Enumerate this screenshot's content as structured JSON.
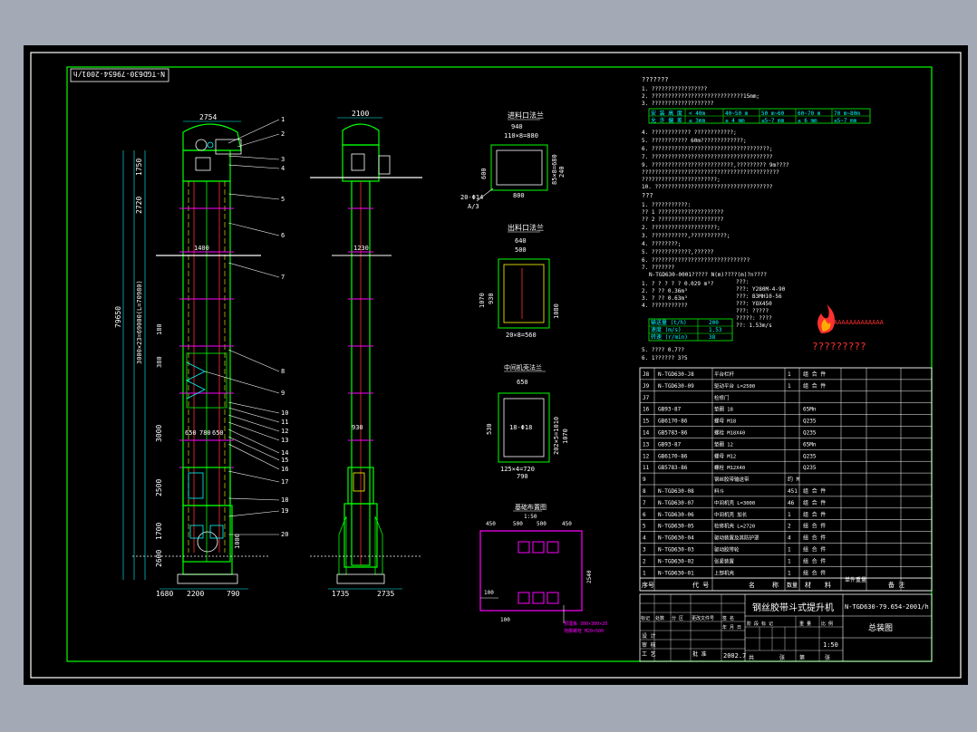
{
  "drawing": {
    "code_box": "N-TGD630-79654-2001/h",
    "code_title": "N-TGD630-79.654-2001/h",
    "machine_name": "钢丝胶带斗式提升机",
    "drawing_name": "总装图",
    "scale": "1:50",
    "date": "2002.7"
  },
  "front_view": {
    "top_width": "2754",
    "dims_left": [
      "1750",
      "2720",
      "79650",
      "3000",
      "2500",
      "1700",
      "2600"
    ],
    "long_dim": "3000×23=69000(L=70980)",
    "mid_dims": [
      "1400",
      "650",
      "780",
      "650"
    ],
    "small_dims": [
      "180",
      "380"
    ],
    "bottom_dims": [
      "1680",
      "2200",
      "790"
    ],
    "callouts": [
      "1",
      "2",
      "3",
      "4",
      "5",
      "6",
      "7",
      "8",
      "9",
      "10",
      "11",
      "12",
      "13",
      "14",
      "15",
      "16",
      "17",
      "18",
      "19",
      "20"
    ],
    "right_dim": "1000"
  },
  "side_view": {
    "top_dim": "2100",
    "mid_dims": [
      "1230",
      "930"
    ],
    "bottom_dims": [
      "1735",
      "2735"
    ]
  },
  "details": {
    "inlet": {
      "title": "进料口法兰",
      "dims": [
        "940",
        "110×8=880",
        "600",
        "800",
        "240",
        "85×8=680"
      ],
      "holes": "20-Φ14",
      "ref": "A/3"
    },
    "outlet": {
      "title": "出料口法兰",
      "dims": [
        "640",
        "500",
        "1070",
        "930",
        "1080",
        "20×8=560"
      ]
    },
    "middle": {
      "title": "中间机壳法兰",
      "dims": [
        "650",
        "530",
        "1070",
        "790",
        "18-Φ18",
        "202×5=1010",
        "125×4=720"
      ]
    },
    "foundation": {
      "title": "基础布置图",
      "subtitle": "1:50",
      "dims": [
        "450",
        "500",
        "500",
        "450",
        "100",
        "2540",
        "100"
      ],
      "note1": "预埋板 300×300×20",
      "note2": "地脚螺栓 M20×500"
    }
  },
  "notes": {
    "title1": "???????",
    "items1": [
      "1. ?????????????????",
      "2. ????????????????????????????15mm;",
      "3. ???????????????????"
    ],
    "table_row1": [
      "安 装 高 度",
      "< 40m",
      "40~50 m",
      "50 m~60",
      "60~70 m",
      "70 m~80m"
    ],
    "table_row2": [
      "允 许 偏 差",
      "≤ 3mm",
      "≤ 4 mm",
      "≤5~7 mm",
      "≤ 6 mm",
      "≤5~7 mm"
    ],
    "items2": [
      "4. ????????????     ????????????;",
      "5. ???????????      60m?????????????;",
      "6. ????????????????????????????????????;",
      "7. ?????????????????????????????????????",
      "9. ?????????????????????????,?????????            9m????",
      "   ??????????????????????????????????????????",
      "   ???????????????????????;",
      "10. ????????????????????????????????????"
    ],
    "title2": "???",
    "items3": [
      "1. ???????????:",
      "   ?? 1 ????????????????????",
      "   ?? 2 ????????????????????",
      "2. ????????????????????;",
      "3. ???????????,???????????;",
      "4. ????????;",
      "5. ????????????,??????",
      "6. ??????????????????????????????",
      "7. ???????"
    ],
    "spec_line": "N-TGD630-0001????? N(m)????(m)?n????",
    "spec_col1": [
      "1. ? ? ? ? ?  0.029 m³?",
      "2. ?     ?? 0.36m³",
      "3. ?     ?? 0.63m³",
      "4. ???????????"
    ],
    "spec_col2": [
      "???:",
      "???: Y280M-4-90",
      "???: B3MH10-56",
      "???: YOX450",
      "???: ?????",
      "?????:   ????",
      "??: 1.53m/s"
    ],
    "perf_table": [
      [
        "输送量  (t/h)",
        "200"
      ],
      [
        "速度  (m/s)",
        "1.53"
      ],
      [
        "转速  (r/min)",
        "38"
      ]
    ],
    "items4": [
      "5. ????  0.7??",
      "6. 1??????  3?5"
    ],
    "logo_text1": "AAAAAAAAAAAAA",
    "logo_text2": "?????????"
  },
  "bom": {
    "rows": [
      [
        "J8",
        "N-TGD630-J8",
        "平台栏杆",
        "1",
        "组 合 件",
        ""
      ],
      [
        "J9",
        "N-TGD630-09",
        "驱动平台 L=2500",
        "1",
        "组 合 件",
        ""
      ],
      [
        "J7",
        "",
        "检修门",
        "",
        "",
        ""
      ],
      [
        "16",
        "GB93-87",
        "垫圈 18",
        "",
        "65Mn",
        ""
      ],
      [
        "15",
        "GB6170-86",
        "螺母 M18",
        "",
        "Q235",
        ""
      ],
      [
        "14",
        "GB5783-86",
        "螺栓 M18X40",
        "",
        "Q235",
        ""
      ],
      [
        "13",
        "GB93-87",
        "垫圈 12",
        "",
        "65Mn",
        ""
      ],
      [
        "12",
        "GB6170-86",
        "螺母 M12",
        "",
        "Q235",
        ""
      ],
      [
        "11",
        "GB5783-86",
        "螺栓 M12X40",
        "",
        "Q235",
        ""
      ],
      [
        "9",
        "",
        "钢丝胶带输送带",
        "约 M",
        "",
        ""
      ],
      [
        "8",
        "N-TGD630-08",
        "料斗",
        "451",
        "组 合 件",
        ""
      ],
      [
        "7",
        "N-TGD630-07",
        "中间机壳 L=3000",
        "46",
        "组 合 件",
        ""
      ],
      [
        "6",
        "N-TGD630-06",
        "中间机壳 加长",
        "1",
        "组 合 件",
        ""
      ],
      [
        "5",
        "N-TGD630-05",
        "检修机壳 L=2720",
        "2",
        "组 合 件",
        ""
      ],
      [
        "4",
        "N-TGD630-04",
        "驱动装置及其防护罩",
        "4",
        "组 合 件",
        ""
      ],
      [
        "3",
        "N-TGD630-03",
        "驱动胶带轮",
        "1",
        "组 合 件",
        ""
      ],
      [
        "2",
        "N-TGD630-02",
        "张紧装置",
        "1",
        "组 合 件",
        ""
      ],
      [
        "1",
        "N-TGD630-01",
        "上部机壳",
        "1",
        "组 合 件",
        ""
      ]
    ],
    "header": [
      "序号",
      "代 号",
      "名",
      "称",
      "数量",
      "材",
      "料",
      "单件重量",
      "备 注"
    ]
  },
  "title_block": {
    "row_labels": [
      "标记",
      "处数",
      "分 区",
      "更改文件号",
      "签 名",
      "年 月 日"
    ],
    "people": [
      "设 计",
      "审 核",
      "工 艺",
      "批 准"
    ],
    "stage_labels": [
      "阶 段 标 记",
      "重 量",
      "比 例"
    ],
    "sheet_labels": [
      "共",
      "张",
      "第",
      "张"
    ]
  },
  "colors": {
    "background": "#a3aab5",
    "canvas": "#000000",
    "outline": "#00ff00",
    "text": "#ffffff",
    "callout": "#ffff00",
    "foundation": "#ff00ff",
    "dimension": "#00ffff",
    "chain": "#ff3030"
  }
}
